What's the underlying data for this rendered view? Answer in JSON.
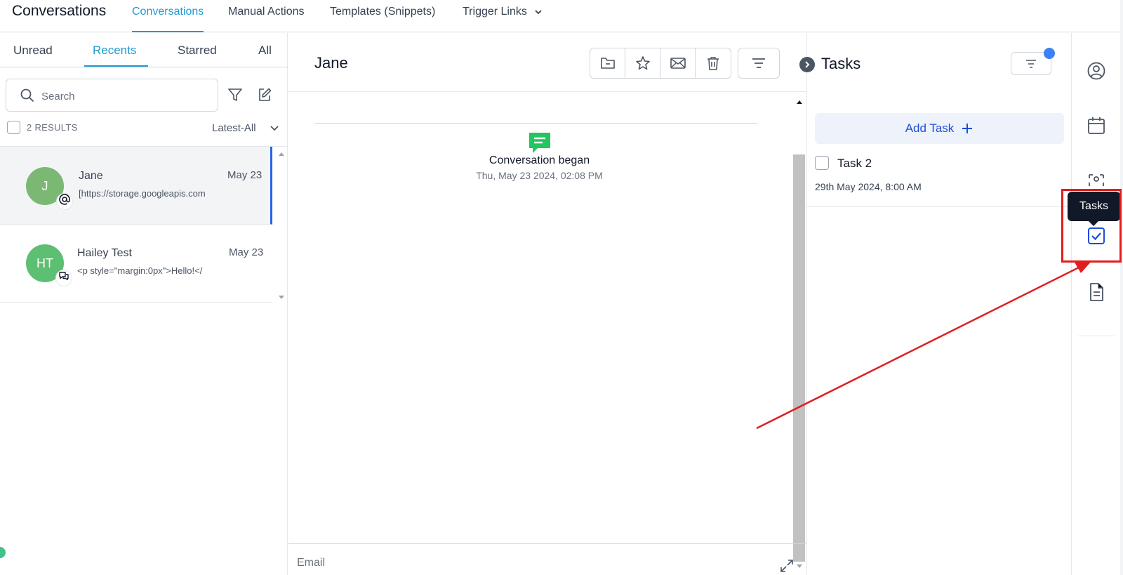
{
  "app": {
    "title": "Conversations"
  },
  "top_nav": {
    "tabs": [
      {
        "label": "Conversations",
        "active": true
      },
      {
        "label": "Manual Actions",
        "active": false
      },
      {
        "label": "Templates (Snippets)",
        "active": false
      },
      {
        "label": "Trigger Links",
        "active": false,
        "has_dropdown": true
      }
    ]
  },
  "left_panel": {
    "tabs": [
      "Unread",
      "Recents",
      "Starred",
      "All"
    ],
    "active_tab": "Recents",
    "search": {
      "placeholder": "Search",
      "value": ""
    },
    "results_label": "2 RESULTS",
    "sort_label": "Latest-All",
    "conversations": [
      {
        "initials": "J",
        "name": "Jane",
        "date": "May 23",
        "preview": "[https://storage.googleapis.com",
        "channel_icon": "at-sign-icon",
        "selected": true
      },
      {
        "initials": "HT",
        "name": "Hailey Test",
        "date": "May 23",
        "preview": "<p style=\"margin:0px\">Hello!</",
        "channel_icon": "chat-bubbles-icon",
        "selected": false
      }
    ]
  },
  "chat": {
    "contact_name": "Jane",
    "actions": [
      "folder-icon",
      "star-icon",
      "mail-icon",
      "trash-icon"
    ],
    "event": {
      "title": "Conversation began",
      "timestamp": "Thu, May 23 2024, 02:08 PM"
    },
    "composer_channel": "Email"
  },
  "tasks_panel": {
    "title": "Tasks",
    "add_label": "Add Task",
    "tasks": [
      {
        "title": "Task 2",
        "due": "29th May 2024, 8:00 AM",
        "done": false
      }
    ]
  },
  "right_rail": {
    "icons": [
      "user-circle-icon",
      "calendar-icon",
      "workflow-icon",
      "tasks-checkbox-icon",
      "document-icon"
    ],
    "active_icon": "tasks-checkbox-icon"
  },
  "tooltip": {
    "text": "Tasks"
  },
  "colors": {
    "accent": "#1d9bd1",
    "selected_border": "#2563eb",
    "annotation_red": "#e11d1d",
    "avatar_green": "#7bb874",
    "chat_icon_green": "#22c55e"
  }
}
